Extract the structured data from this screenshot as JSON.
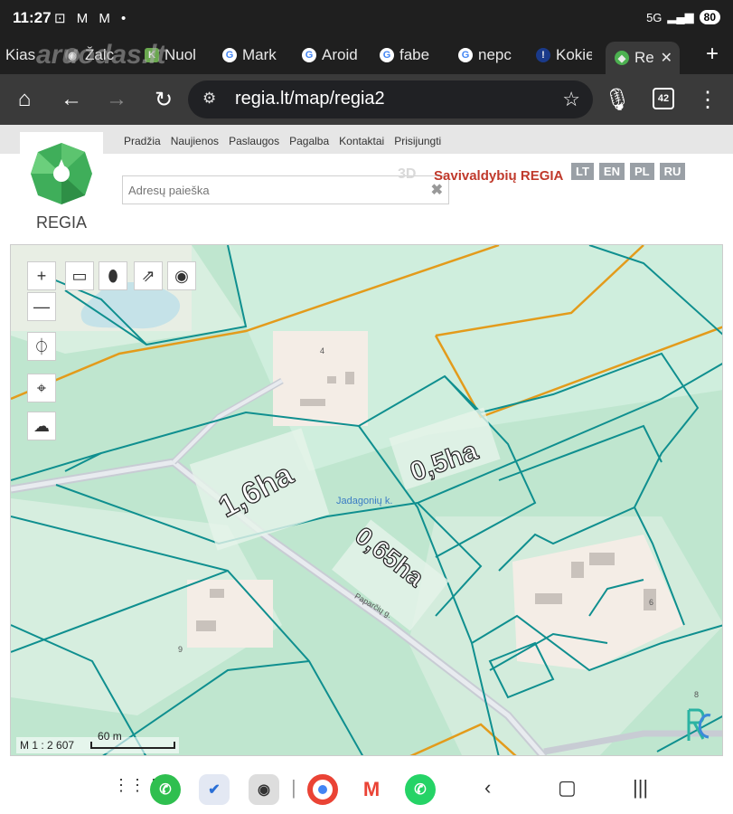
{
  "status": {
    "time": "11:27",
    "icons": "⊡ M M •",
    "network": "5G",
    "battery": "80"
  },
  "tabs": [
    {
      "label": "Kias",
      "favicon": "",
      "color": "#555"
    },
    {
      "label": "Žalc",
      "favicon": "◉",
      "color": "#777"
    },
    {
      "label": "Nuol",
      "favicon": "K",
      "color": "#6aa84f"
    },
    {
      "label": "Mark",
      "favicon": "G",
      "color": "#fff"
    },
    {
      "label": "Aroid",
      "favicon": "G",
      "color": "#fff"
    },
    {
      "label": "fabe",
      "favicon": "G",
      "color": "#fff"
    },
    {
      "label": "nepc",
      "favicon": "G",
      "color": "#fff"
    },
    {
      "label": "Kokie",
      "favicon": "!",
      "color": "#1a3a8a"
    },
    {
      "label": "Re",
      "favicon": "◆",
      "color": "#4cb050"
    }
  ],
  "watermark": "aruodas.lt",
  "url": "regia.lt/map/regia2",
  "tab_count": "42",
  "site": {
    "logo_text": "REGIA",
    "menu": [
      "Pradžia",
      "Naujienos",
      "Paslaugos",
      "Pagalba",
      "Kontaktai",
      "Prisijungti"
    ],
    "search_placeholder": "Adresų paieška",
    "d3": "3D",
    "brand": "Savivaldybių REGIA",
    "langs": [
      "LT",
      "EN",
      "PL",
      "RU"
    ]
  },
  "map": {
    "labels": {
      "area1": "1,6ha",
      "area2": "0,5ha",
      "area3": "0,65ha",
      "village": "Jadagonių k.",
      "road": "Paparčių g.",
      "n4": "4",
      "n6": "6",
      "n8": "8",
      "n9": "9"
    },
    "scale_ratio": "M 1 : 2 607",
    "scale_bar": "60 m"
  },
  "colors": {
    "forest": "#bfe6cf",
    "field": "#d8efe0",
    "parcel": "#0f8f8f",
    "boundary": "#e39b1b",
    "building": "#f4ede6",
    "water": "#7fd3ea",
    "brand": "#c0392b"
  }
}
